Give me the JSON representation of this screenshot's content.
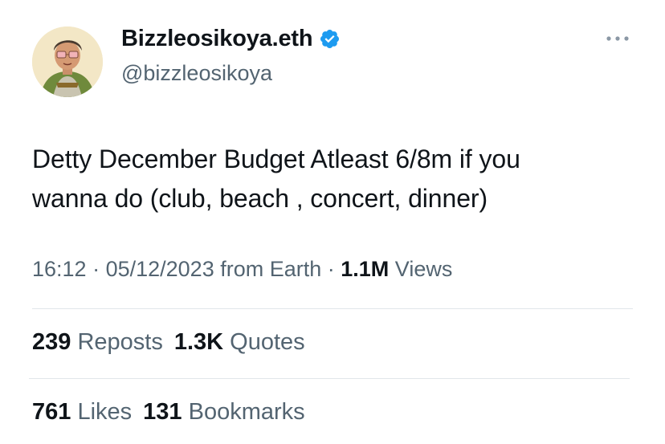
{
  "author": {
    "display_name": "Bizzleosikoya.eth",
    "handle": "@bizzleosikoya",
    "verified": true
  },
  "tweet": {
    "text_line1": "Detty December Budget Atleast 6/8m if you",
    "text_line2": "wanna do (club, beach , concert, dinner)"
  },
  "meta": {
    "time": "16:12",
    "sep1": " · ",
    "date": "05/12/2023",
    "source": " from Earth",
    "sep2": " · ",
    "views_count": "1.1M",
    "views_label": " Views"
  },
  "stats": {
    "reposts_count": "239",
    "reposts_label": " Reposts",
    "quotes_count": "1.3K",
    "quotes_label": " Quotes",
    "likes_count": "761",
    "likes_label": " Likes",
    "bookmarks_count": "131",
    "bookmarks_label": " Bookmarks"
  },
  "colors": {
    "verified_blue": "#1d9bf0",
    "secondary_text": "#536471",
    "primary_text": "#0f1419",
    "divider": "#e1e6ea"
  },
  "icons": [
    "verified-badge-icon",
    "more-options-icon"
  ]
}
